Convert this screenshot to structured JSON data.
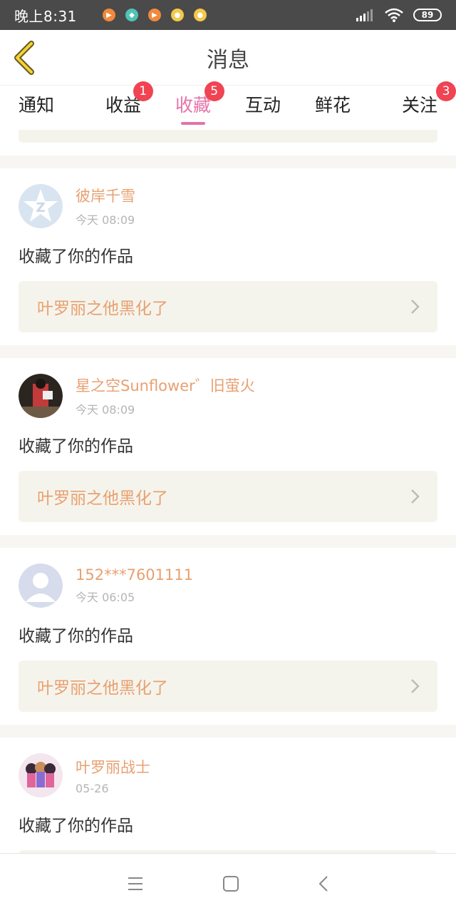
{
  "status_bar": {
    "time": "晚上8:31",
    "battery": "89"
  },
  "header": {
    "title": "消息"
  },
  "tabs": [
    {
      "label": "通知",
      "badge": ""
    },
    {
      "label": "收益",
      "badge": "1"
    },
    {
      "label": "收藏",
      "badge": "5",
      "active": true
    },
    {
      "label": "互动",
      "badge": ""
    },
    {
      "label": "鲜花",
      "badge": ""
    },
    {
      "label": "关注",
      "badge": "3"
    }
  ],
  "messages": [
    {
      "user": "彼岸千雪",
      "time": "今天 08:09",
      "action": "收藏了你的作品",
      "work": "叶罗丽之他黑化了"
    },
    {
      "user": "星之空Sunflower゛旧萤火",
      "time": "今天 08:09",
      "action": "收藏了你的作品",
      "work": "叶罗丽之他黑化了"
    },
    {
      "user": "152***7601111",
      "time": "今天 06:05",
      "action": "收藏了你的作品",
      "work": "叶罗丽之他黑化了"
    },
    {
      "user": "叶罗丽战士",
      "time": "05-26",
      "action": "收藏了你的作品",
      "work": ""
    }
  ],
  "icons": {
    "back": "chevron-left-icon",
    "arrow": "chevron-right-icon",
    "nav": [
      "menu-icon",
      "home-square-icon",
      "back-triangle-icon"
    ]
  },
  "colors": {
    "accent": "#e573a8",
    "orange": "#e8a070",
    "badge": "#f04453"
  }
}
